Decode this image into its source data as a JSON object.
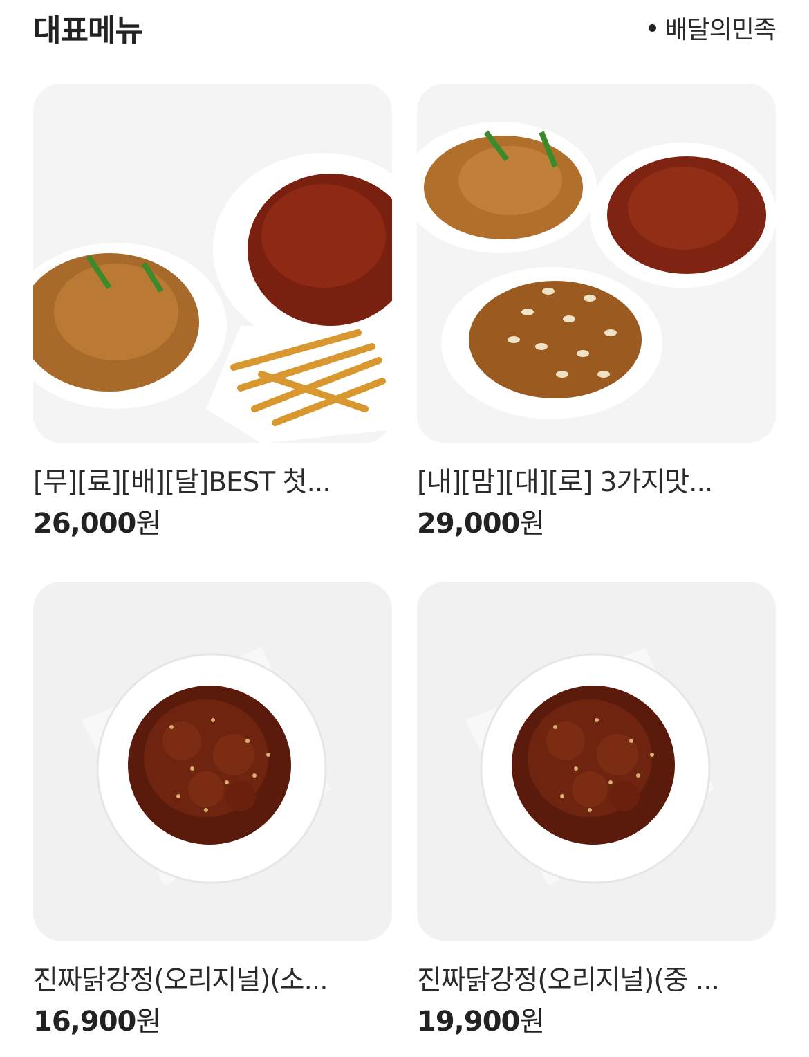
{
  "header": {
    "title": "대표메뉴",
    "source": "배달의민족"
  },
  "menu": [
    {
      "name": "[무][료][배][달]BEST 첫...",
      "price": "26,000",
      "unit": "원",
      "image": "chicken-combo-with-fries-image"
    },
    {
      "name": "[내][맘][대][로] 3가지맛...",
      "price": "29,000",
      "unit": "원",
      "image": "three-flavor-chicken-image"
    },
    {
      "name": "진짜닭강정(오리지널)(소...",
      "price": "16,900",
      "unit": "원",
      "image": "dakgangjeong-plate-image"
    },
    {
      "name": "진짜닭강정(오리지널)(중 ...",
      "price": "19,900",
      "unit": "원",
      "image": "dakgangjeong-plate-image"
    }
  ]
}
